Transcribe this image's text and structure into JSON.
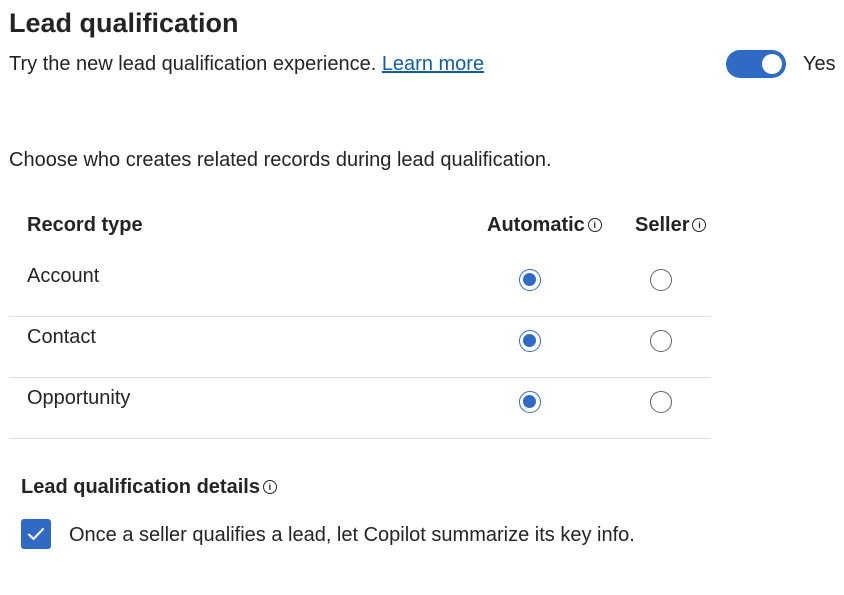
{
  "header": {
    "title": "Lead qualification",
    "subtitle": "Try the new lead qualification experience.",
    "learn_more": "Learn more",
    "toggle_label": "Yes",
    "toggle_on": true
  },
  "record_section": {
    "description": "Choose who creates related records during lead qualification.",
    "columns": {
      "record_type": "Record type",
      "automatic": "Automatic",
      "seller": "Seller"
    },
    "rows": [
      {
        "label": "Account",
        "selected": "Automatic"
      },
      {
        "label": "Contact",
        "selected": "Automatic"
      },
      {
        "label": "Opportunity",
        "selected": "Automatic"
      }
    ]
  },
  "details": {
    "title": "Lead qualification details",
    "checkbox_label": "Once a seller qualifies a lead, let Copilot summarize its key info.",
    "checked": true
  },
  "colors": {
    "accent": "#2f6bc4",
    "link": "#115ea3",
    "text": "#242424",
    "divider": "#e0e0e0"
  }
}
